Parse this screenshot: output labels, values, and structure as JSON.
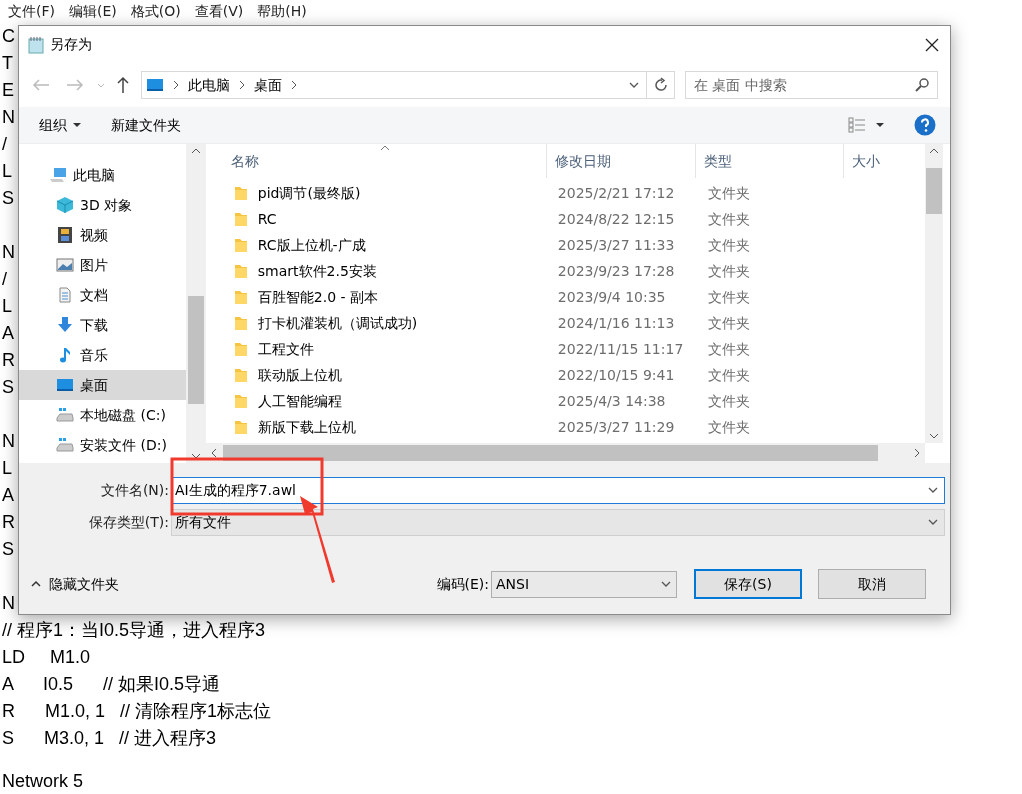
{
  "menu_bar": [
    "文件(F)",
    "编辑(E)",
    "格式(O)",
    "查看(V)",
    "帮助(H)"
  ],
  "editor": {
    "blocks": [
      [
        "C",
        "T",
        "E",
        "N",
        "/",
        "L",
        "S"
      ],
      [
        "N",
        "/",
        "L",
        "A",
        "R",
        "S"
      ],
      [
        "N",
        "L",
        "A",
        "R",
        "S"
      ],
      [
        "N",
        "// 程序1：当I0.5导通，进入程序3",
        "LD     M1.0",
        "A      I0.5      // 如果I0.5导通",
        "R      M1.0, 1   // 清除程序1标志位",
        "S      M3.0, 1   // 进入程序3"
      ],
      [
        "Network 5"
      ]
    ]
  },
  "dialog": {
    "title": "另存为",
    "address": [
      "此电脑",
      "桌面"
    ],
    "search": {
      "placeholder": "在 桌面 中搜索"
    },
    "toolbar": [
      "组织",
      "新建文件夹"
    ],
    "nav_items": [
      {
        "label": "此电脑",
        "kind": "pc",
        "selected": false
      },
      {
        "label": "3D 对象",
        "kind": "cube",
        "selected": false
      },
      {
        "label": "视频",
        "kind": "film",
        "selected": false
      },
      {
        "label": "图片",
        "kind": "image",
        "selected": false
      },
      {
        "label": "文档",
        "kind": "doc",
        "selected": false
      },
      {
        "label": "下载",
        "kind": "download",
        "selected": false
      },
      {
        "label": "音乐",
        "kind": "music",
        "selected": false
      },
      {
        "label": "桌面",
        "kind": "desktop",
        "selected": true
      },
      {
        "label": "本地磁盘 (C:)",
        "kind": "drive",
        "selected": false
      },
      {
        "label": "安装文件 (D:)",
        "kind": "drive",
        "selected": false
      }
    ],
    "columns": [
      "名称",
      "修改日期",
      "类型",
      "大小"
    ],
    "files": [
      {
        "name": "pid调节(最终版)",
        "modified": "2025/2/21 17:12",
        "type": "文件夹"
      },
      {
        "name": "RC",
        "modified": "2024/8/22 12:15",
        "type": "文件夹"
      },
      {
        "name": "RC版上位机-广成",
        "modified": "2025/3/27 11:33",
        "type": "文件夹"
      },
      {
        "name": "smart软件2.5安装",
        "modified": "2023/9/23 17:28",
        "type": "文件夹"
      },
      {
        "name": "百胜智能2.0 - 副本",
        "modified": "2023/9/4 10:35",
        "type": "文件夹"
      },
      {
        "name": "打卡机灌装机（调试成功)",
        "modified": "2024/1/16 11:13",
        "type": "文件夹"
      },
      {
        "name": "工程文件",
        "modified": "2022/11/15 11:17",
        "type": "文件夹"
      },
      {
        "name": "联动版上位机",
        "modified": "2022/10/15 9:41",
        "type": "文件夹"
      },
      {
        "name": "人工智能编程",
        "modified": "2025/4/3 14:38",
        "type": "文件夹"
      },
      {
        "name": "新版下载上位机",
        "modified": "2025/3/27 11:29",
        "type": "文件夹"
      }
    ],
    "filename": {
      "label": "文件名(N):",
      "value": "AI生成的程序7.awl"
    },
    "filetype": {
      "label": "保存类型(T):",
      "value": "所有文件"
    },
    "hide_folders": "隐藏文件夹",
    "encoding": {
      "label": "编码(E):",
      "value": "ANSI"
    },
    "buttons": [
      {
        "label": "保存(S)",
        "default": true
      },
      {
        "label": "取消",
        "default": false
      }
    ]
  }
}
